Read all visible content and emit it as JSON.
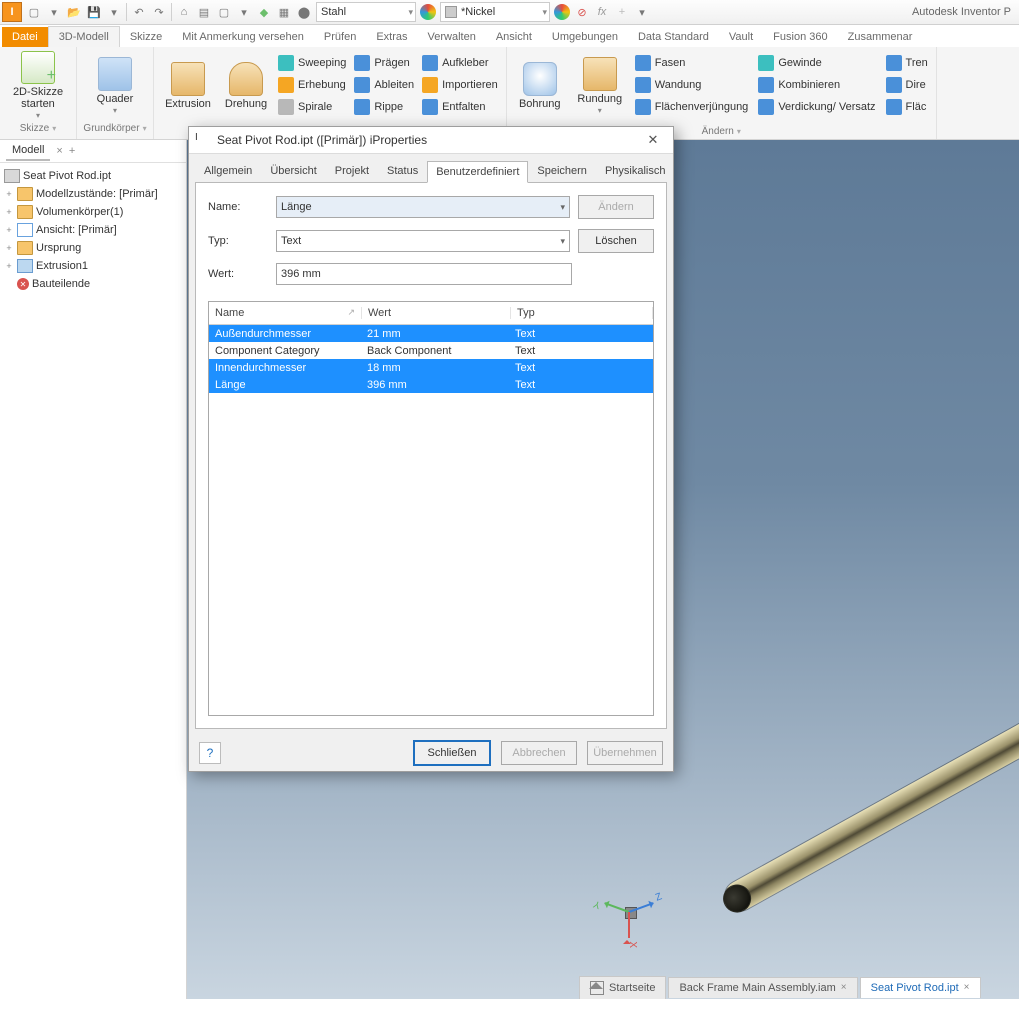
{
  "app_title": "Autodesk Inventor P",
  "qat_material": "Stahl",
  "qat_appearance": "*Nickel",
  "tabs": {
    "file": "Datei",
    "items": [
      "3D-Modell",
      "Skizze",
      "Mit Anmerkung versehen",
      "Prüfen",
      "Extras",
      "Verwalten",
      "Ansicht",
      "Umgebungen",
      "Data Standard",
      "Vault",
      "Fusion 360",
      "Zusammenar"
    ]
  },
  "ribbon": {
    "sketch": {
      "btn": "2D-Skizze starten",
      "group": "Skizze"
    },
    "primitives": {
      "btn": "Quader",
      "group": "Grundkörper"
    },
    "create": {
      "extrusion": "Extrusion",
      "rotate": "Drehung",
      "sweeping": "Sweeping",
      "praegen": "Prägen",
      "aufkleber": "Aufkleber",
      "erhebung": "Erhebung",
      "ableiten": "Ableiten",
      "importieren": "Importieren",
      "spirale": "Spirale",
      "rippe": "Rippe",
      "entfalten": "Entfalten"
    },
    "bore": {
      "bohrung": "Bohrung",
      "rundung": "Rundung",
      "fasen": "Fasen",
      "gewinde": "Gewinde",
      "trennen": "Tren",
      "wandung": "Wandung",
      "kombinieren": "Kombinieren",
      "direkt": "Dire",
      "flaechen": "Flächenverjüngung",
      "verdickung": "Verdickung/ Versatz",
      "flaeche": "Fläc",
      "group": "Ändern"
    }
  },
  "browser": {
    "tab": "Modell",
    "root": "Seat Pivot Rod.ipt",
    "items": [
      "Modellzustände: [Primär]",
      "Volumenkörper(1)",
      "Ansicht: [Primär]",
      "Ursprung",
      "Extrusion1",
      "Bauteilende"
    ]
  },
  "dialog": {
    "title": "Seat Pivot Rod.ipt ([Primär]) iProperties",
    "tabs": [
      "Allgemein",
      "Übersicht",
      "Projekt",
      "Status",
      "Benutzerdefiniert",
      "Speichern",
      "Physikalisch"
    ],
    "labels": {
      "name": "Name:",
      "typ": "Typ:",
      "wert": "Wert:"
    },
    "name_value": "Länge",
    "typ_value": "Text",
    "wert_value": "396 mm",
    "btn_change": "Ändern",
    "btn_delete": "Löschen",
    "columns": {
      "name": "Name",
      "wert": "Wert",
      "typ": "Typ"
    },
    "rows": [
      {
        "name": "Außendurchmesser",
        "wert": "21 mm",
        "typ": "Text",
        "sel": true
      },
      {
        "name": "Component Category",
        "wert": "Back Component",
        "typ": "Text",
        "sel": false
      },
      {
        "name": "Innendurchmesser",
        "wert": "18 mm",
        "typ": "Text",
        "sel": true
      },
      {
        "name": "Länge",
        "wert": "396 mm",
        "typ": "Text",
        "sel": true
      }
    ],
    "close": "Schließen",
    "cancel": "Abbrechen",
    "apply": "Übernehmen"
  },
  "doctabs": {
    "home": "Startseite",
    "asm": "Back Frame Main Assembly.iam",
    "part": "Seat Pivot Rod.ipt"
  }
}
